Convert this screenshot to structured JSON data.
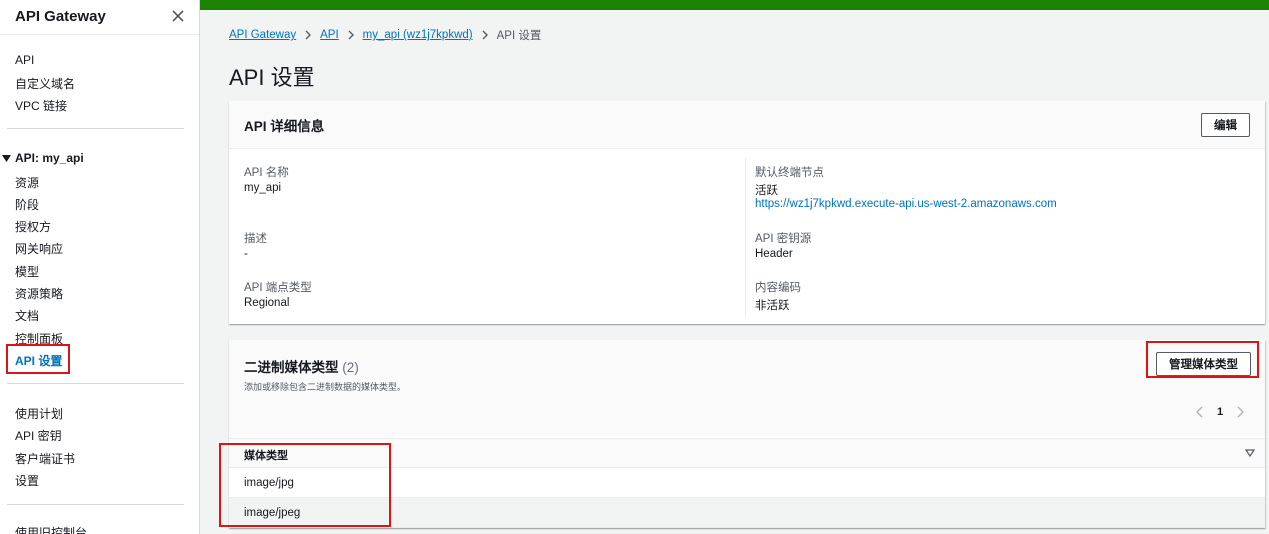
{
  "sidebar": {
    "title": "API Gateway",
    "top_items": [
      "API",
      "自定义域名",
      "VPC 链接"
    ],
    "group_label": "API: my_api",
    "group_items": [
      "资源",
      "阶段",
      "授权方",
      "网关响应",
      "模型",
      "资源策略",
      "文档",
      "控制面板",
      "API 设置"
    ],
    "bottom_items": [
      "使用计划",
      "API 密钥",
      "客户端证书",
      "设置"
    ],
    "footer_item": "使用旧控制台"
  },
  "breadcrumb": [
    "API Gateway",
    "API",
    "my_api (wz1j7kpkwd)",
    "API 设置"
  ],
  "page": {
    "title": "API 设置"
  },
  "details": {
    "title": "API 详细信息",
    "edit_label": "编辑",
    "api_name_label": "API 名称",
    "api_name": "my_api",
    "desc_label": "描述",
    "desc": "-",
    "endpoint_type_label": "API 端点类型",
    "endpoint_type": "Regional",
    "default_endpoint_label": "默认终端节点",
    "default_endpoint_status": "活跃",
    "default_endpoint_url": "https://wz1j7kpkwd.execute-api.us-west-2.amazonaws.com",
    "key_source_label": "API 密钥源",
    "key_source": "Header",
    "content_encoding_label": "内容编码",
    "content_encoding": "非活跃"
  },
  "binary": {
    "title": "二进制媒体类型",
    "count": "(2)",
    "description": "添加或移除包含二进制数据的媒体类型。",
    "manage_label": "管理媒体类型",
    "page_number": "1",
    "column_header": "媒体类型",
    "rows": [
      "image/jpg",
      "image/jpeg"
    ]
  },
  "colors": {
    "accent": "#0073bb",
    "topbar": "#1d8102",
    "highlight": "#d91515"
  }
}
